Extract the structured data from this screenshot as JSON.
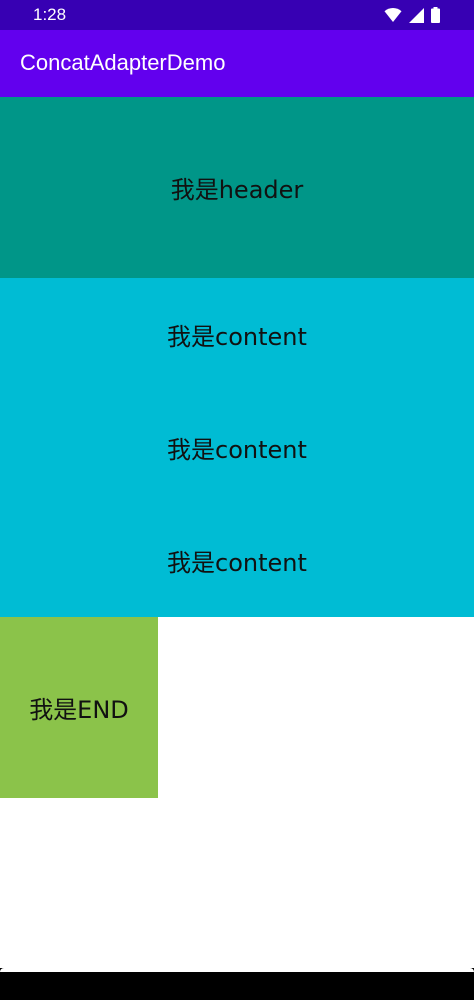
{
  "status_bar": {
    "time": "1:28",
    "icons": [
      "wifi-icon",
      "cellular-signal-icon",
      "battery-icon"
    ],
    "color": "#3700b3"
  },
  "app_bar": {
    "title": "ConcatAdapterDemo",
    "color": "#6200ee"
  },
  "list": {
    "header": {
      "text": "我是header",
      "color": "#009688"
    },
    "contents": [
      {
        "text": "我是content"
      },
      {
        "text": "我是content"
      },
      {
        "text": "我是content"
      }
    ],
    "content_color": "#00bcd4",
    "end": {
      "text": "我是END",
      "color": "#8bc34a"
    }
  },
  "navigation_bar": {
    "color": "#000000"
  }
}
